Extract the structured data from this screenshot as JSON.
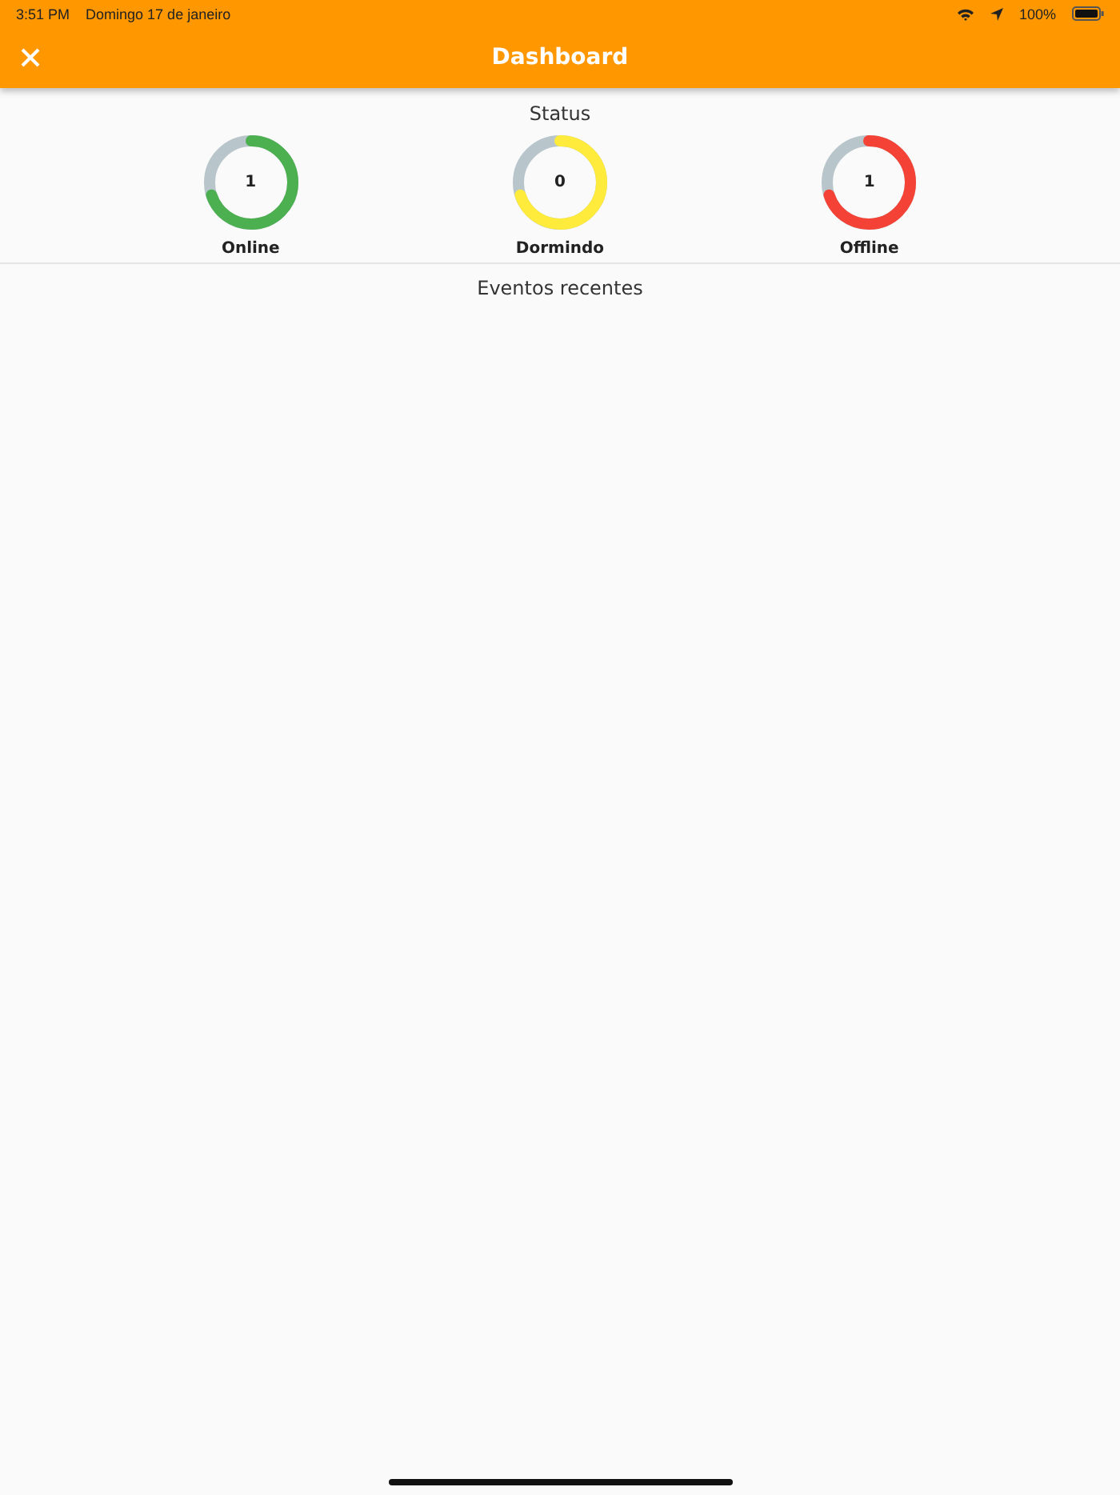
{
  "status_bar": {
    "time": "3:51 PM",
    "date": "Domingo 17 de janeiro",
    "battery": "100%"
  },
  "app_bar": {
    "title": "Dashboard"
  },
  "status_section": {
    "title": "Status",
    "gauges": [
      {
        "label": "Online",
        "value": "1",
        "level": 0.7,
        "color": "#4caf50"
      },
      {
        "label": "Dormindo",
        "value": "0",
        "level": 0.7,
        "color": "#ffeb3b"
      },
      {
        "label": "Offline",
        "value": "1",
        "level": 0.7,
        "color": "#f44336"
      }
    ]
  },
  "events_section": {
    "title": "Eventos recentes"
  }
}
